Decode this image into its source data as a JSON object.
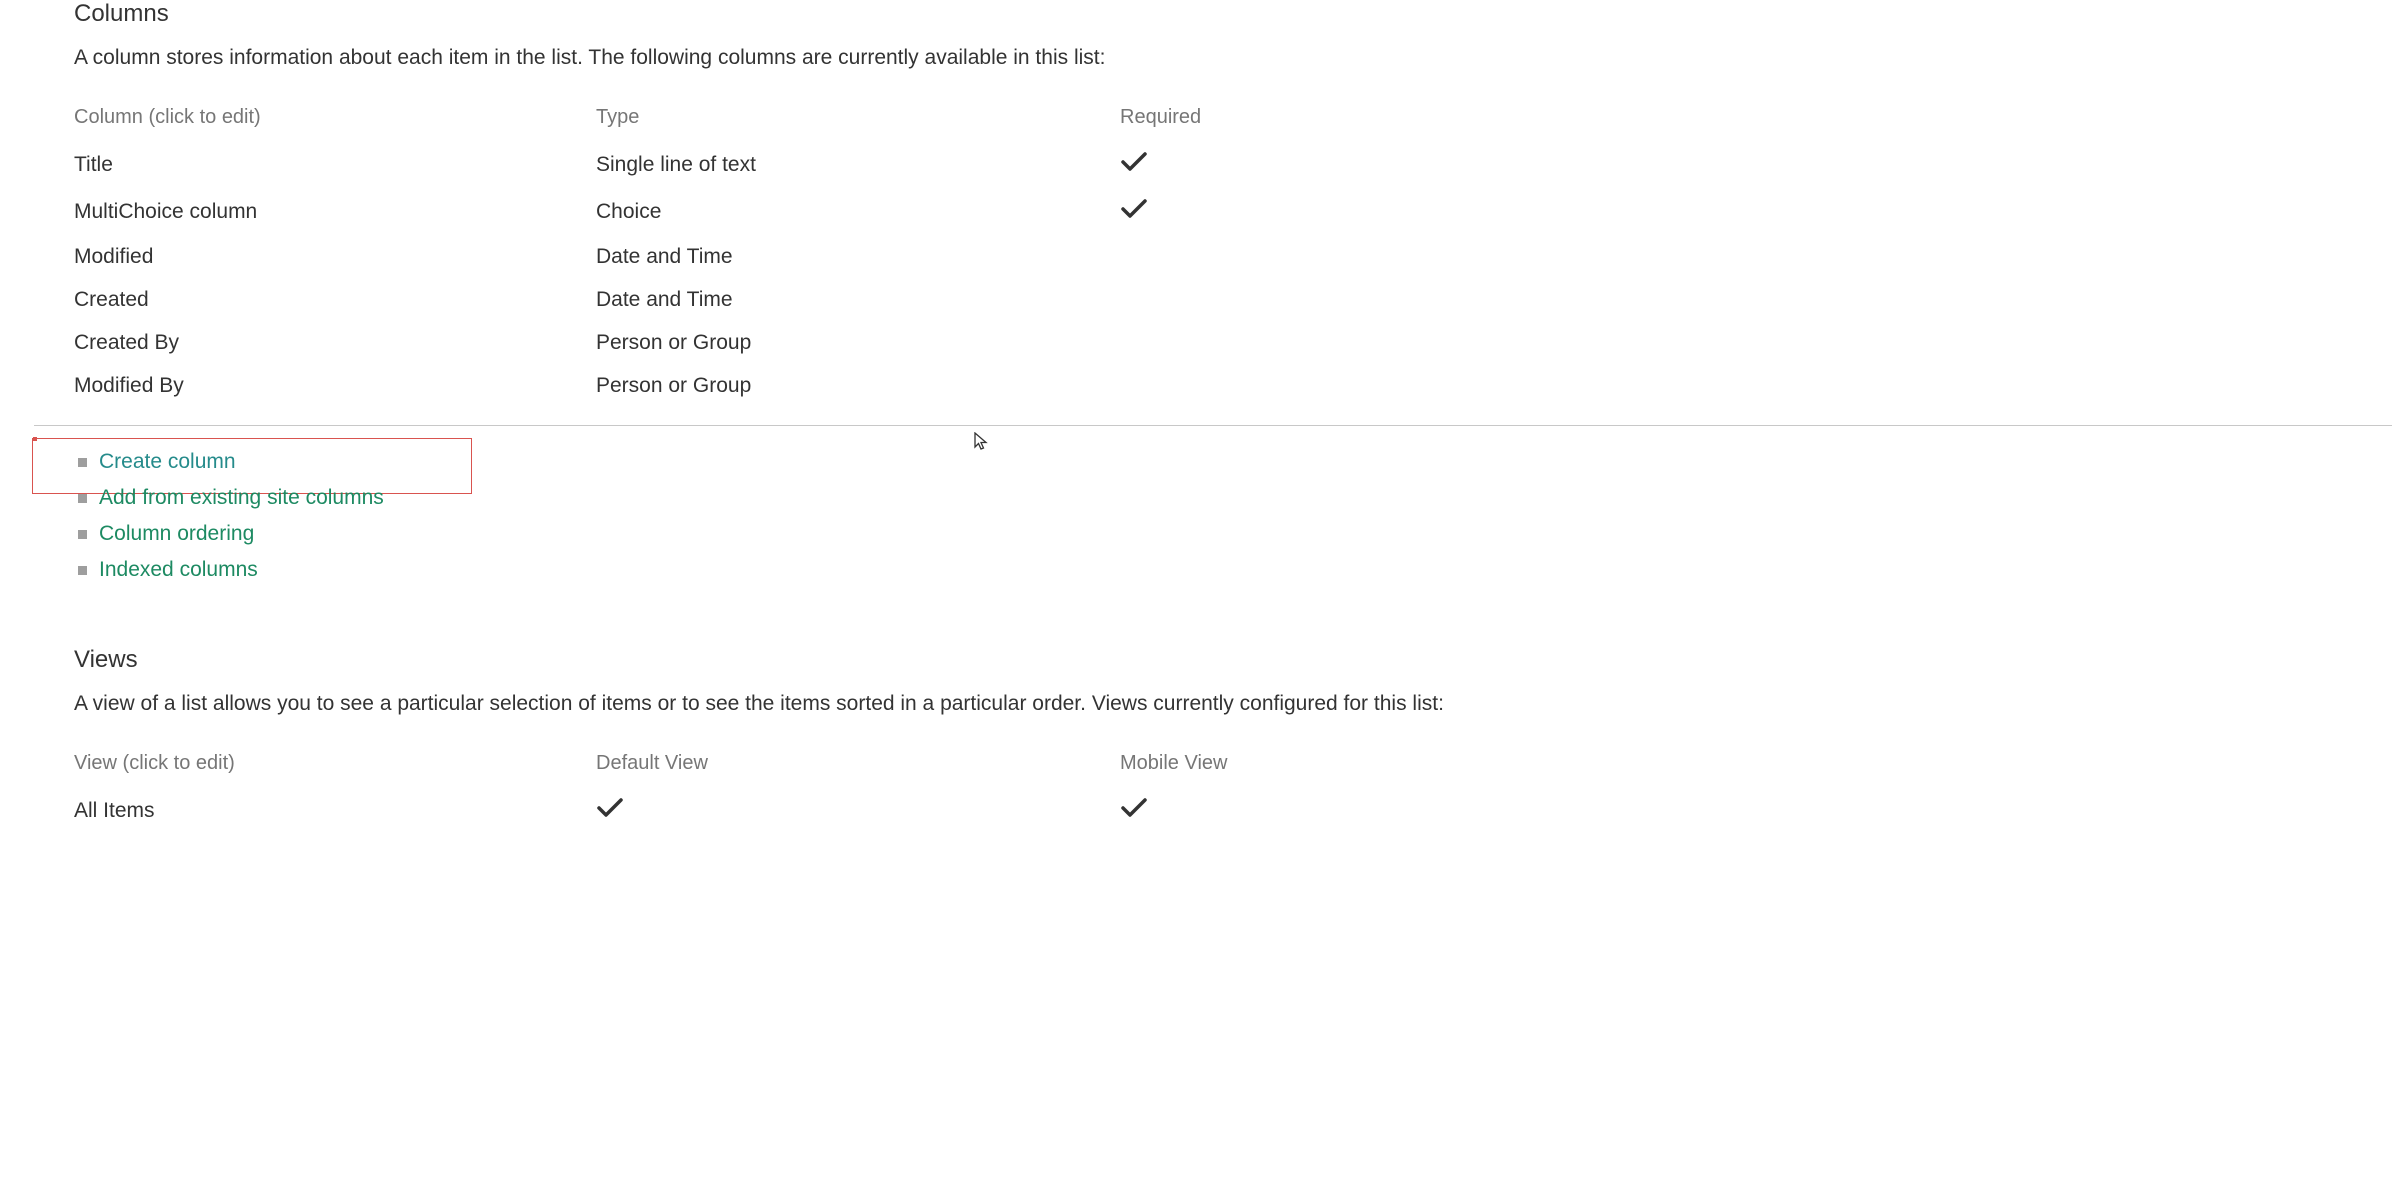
{
  "columns": {
    "title": "Columns",
    "description": "A column stores information about each item in the list. The following columns are currently available in this list:",
    "headers": {
      "name": "Column (click to edit)",
      "type": "Type",
      "required": "Required"
    },
    "rows": [
      {
        "name": "Title",
        "type": "Single line of text",
        "required": true
      },
      {
        "name": "MultiChoice column",
        "type": "Choice",
        "required": true
      },
      {
        "name": "Modified",
        "type": "Date and Time",
        "required": false
      },
      {
        "name": "Created",
        "type": "Date and Time",
        "required": false
      },
      {
        "name": "Created By",
        "type": "Person or Group",
        "required": false
      },
      {
        "name": "Modified By",
        "type": "Person or Group",
        "required": false
      }
    ],
    "actions": [
      {
        "label": "Create column",
        "highlight": true,
        "class": "teal"
      },
      {
        "label": "Add from existing site columns",
        "highlight": false,
        "class": ""
      },
      {
        "label": "Column ordering",
        "highlight": false,
        "class": ""
      },
      {
        "label": "Indexed columns",
        "highlight": false,
        "class": ""
      }
    ]
  },
  "views": {
    "title": "Views",
    "description": "A view of a list allows you to see a particular selection of items or to see the items sorted in a particular order. Views currently configured for this list:",
    "headers": {
      "name": "View (click to edit)",
      "default": "Default View",
      "mobile": "Mobile View"
    },
    "rows": [
      {
        "name": "All Items",
        "default": true,
        "mobile": true
      }
    ]
  }
}
